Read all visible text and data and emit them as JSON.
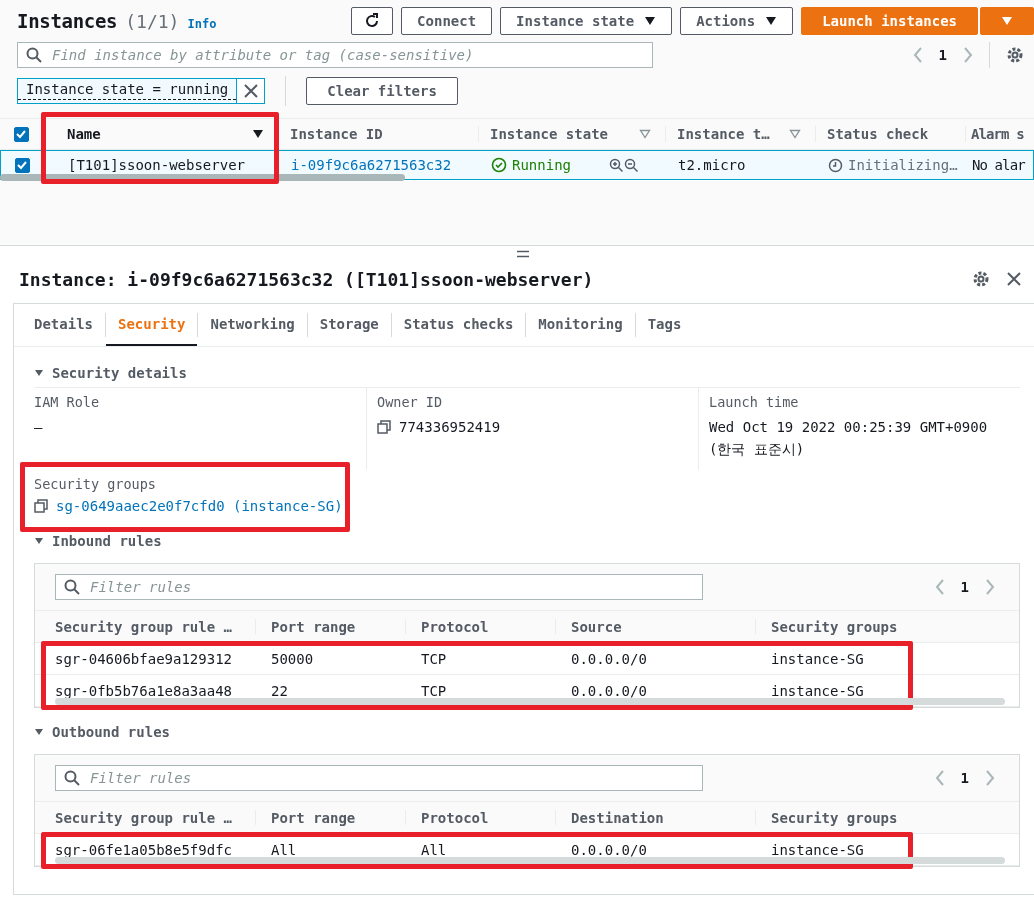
{
  "header": {
    "title": "Instances",
    "count": "(1/1)",
    "info_link": "Info"
  },
  "actions": [
    {
      "kind": "refresh"
    },
    {
      "kind": "plain",
      "label": "Connect"
    },
    {
      "kind": "menu",
      "label": "Instance state"
    },
    {
      "kind": "menu",
      "label": "Actions"
    },
    {
      "kind": "primary",
      "label": "Launch instances"
    },
    {
      "kind": "primary-menu"
    }
  ],
  "search": {
    "placeholder": "Find instance by attribute or tag (case-sensitive)"
  },
  "pagination": {
    "page": "1"
  },
  "filter": {
    "token": "Instance state = running",
    "clear": "Clear filters"
  },
  "table": {
    "all_checked": true,
    "name_column_highlighted": true,
    "columns": [
      {
        "label": "Name",
        "kind": "sorted"
      },
      {
        "label": "Instance ID",
        "kind": "plain"
      },
      {
        "label": "Instance state",
        "kind": "filterable"
      },
      {
        "label": "Instance t…",
        "kind": "filterable"
      },
      {
        "label": "Status check",
        "kind": "plain"
      },
      {
        "label": "Alarm s",
        "kind": "plain"
      }
    ],
    "rows": [
      {
        "selected": true,
        "checked": true,
        "name": "[T101]ssoon-webserver",
        "instance_id": "i-09f9c6a6271563c32",
        "state": "Running",
        "type": "t2.micro",
        "status": "Initializing…",
        "alarm": "No alar"
      }
    ]
  },
  "detail": {
    "title": "Instance: i-09f9c6a6271563c32 ([T101]ssoon-webserver)",
    "tabs": [
      {
        "label": "Details",
        "selected": false
      },
      {
        "label": "Security",
        "selected": true
      },
      {
        "label": "Networking",
        "selected": false
      },
      {
        "label": "Storage",
        "selected": false
      },
      {
        "label": "Status checks",
        "selected": false
      },
      {
        "label": "Monitoring",
        "selected": false
      },
      {
        "label": "Tags",
        "selected": false
      }
    ],
    "security": {
      "heading": "Security details",
      "expanded": true,
      "fields": [
        {
          "label": "IAM Role",
          "value": "–",
          "copy": false
        },
        {
          "label": "Owner ID",
          "value": "774336952419",
          "copy": true
        },
        {
          "label": "Launch time",
          "value": "Wed Oct 19 2022 00:25:39 GMT+0900 (한국 표준시)",
          "copy": false
        }
      ],
      "security_groups": {
        "label": "Security groups",
        "link": "sg-0649aaec2e0f7cfd0 (instance-SG)",
        "highlighted": true
      }
    },
    "rule_tables": [
      {
        "heading": "Inbound rules",
        "expanded": true,
        "placeholder": "Filter rules",
        "page": "1",
        "rows_highlighted": true,
        "columns": [
          "Security group rule …",
          "Port range",
          "Protocol",
          "Source",
          "Security groups"
        ],
        "rows": [
          [
            "sgr-04606bfae9a129312",
            "50000",
            "TCP",
            "0.0.0.0/0",
            "instance-SG"
          ],
          [
            "sgr-0fb5b76a1e8a3aa48",
            "22",
            "TCP",
            "0.0.0.0/0",
            "instance-SG"
          ]
        ]
      },
      {
        "heading": "Outbound rules",
        "expanded": true,
        "placeholder": "Filter rules",
        "page": "1",
        "rows_highlighted": true,
        "columns": [
          "Security group rule …",
          "Port range",
          "Protocol",
          "Destination",
          "Security groups"
        ],
        "rows": [
          [
            "sgr-06fe1a05b8e5f9dfc",
            "All",
            "All",
            "0.0.0.0/0",
            "instance-SG"
          ]
        ]
      }
    ]
  }
}
